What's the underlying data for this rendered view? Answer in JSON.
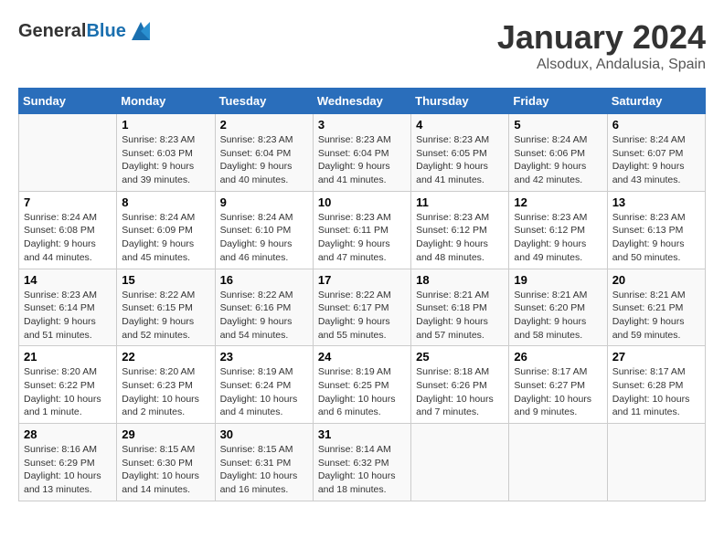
{
  "header": {
    "logo_general": "General",
    "logo_blue": "Blue",
    "title": "January 2024",
    "location": "Alsodux, Andalusia, Spain"
  },
  "days_of_week": [
    "Sunday",
    "Monday",
    "Tuesday",
    "Wednesday",
    "Thursday",
    "Friday",
    "Saturday"
  ],
  "weeks": [
    [
      {
        "day": "",
        "info": ""
      },
      {
        "day": "1",
        "info": "Sunrise: 8:23 AM\nSunset: 6:03 PM\nDaylight: 9 hours\nand 39 minutes."
      },
      {
        "day": "2",
        "info": "Sunrise: 8:23 AM\nSunset: 6:04 PM\nDaylight: 9 hours\nand 40 minutes."
      },
      {
        "day": "3",
        "info": "Sunrise: 8:23 AM\nSunset: 6:04 PM\nDaylight: 9 hours\nand 41 minutes."
      },
      {
        "day": "4",
        "info": "Sunrise: 8:23 AM\nSunset: 6:05 PM\nDaylight: 9 hours\nand 41 minutes."
      },
      {
        "day": "5",
        "info": "Sunrise: 8:24 AM\nSunset: 6:06 PM\nDaylight: 9 hours\nand 42 minutes."
      },
      {
        "day": "6",
        "info": "Sunrise: 8:24 AM\nSunset: 6:07 PM\nDaylight: 9 hours\nand 43 minutes."
      }
    ],
    [
      {
        "day": "7",
        "info": "Sunrise: 8:24 AM\nSunset: 6:08 PM\nDaylight: 9 hours\nand 44 minutes."
      },
      {
        "day": "8",
        "info": "Sunrise: 8:24 AM\nSunset: 6:09 PM\nDaylight: 9 hours\nand 45 minutes."
      },
      {
        "day": "9",
        "info": "Sunrise: 8:24 AM\nSunset: 6:10 PM\nDaylight: 9 hours\nand 46 minutes."
      },
      {
        "day": "10",
        "info": "Sunrise: 8:23 AM\nSunset: 6:11 PM\nDaylight: 9 hours\nand 47 minutes."
      },
      {
        "day": "11",
        "info": "Sunrise: 8:23 AM\nSunset: 6:12 PM\nDaylight: 9 hours\nand 48 minutes."
      },
      {
        "day": "12",
        "info": "Sunrise: 8:23 AM\nSunset: 6:12 PM\nDaylight: 9 hours\nand 49 minutes."
      },
      {
        "day": "13",
        "info": "Sunrise: 8:23 AM\nSunset: 6:13 PM\nDaylight: 9 hours\nand 50 minutes."
      }
    ],
    [
      {
        "day": "14",
        "info": "Sunrise: 8:23 AM\nSunset: 6:14 PM\nDaylight: 9 hours\nand 51 minutes."
      },
      {
        "day": "15",
        "info": "Sunrise: 8:22 AM\nSunset: 6:15 PM\nDaylight: 9 hours\nand 52 minutes."
      },
      {
        "day": "16",
        "info": "Sunrise: 8:22 AM\nSunset: 6:16 PM\nDaylight: 9 hours\nand 54 minutes."
      },
      {
        "day": "17",
        "info": "Sunrise: 8:22 AM\nSunset: 6:17 PM\nDaylight: 9 hours\nand 55 minutes."
      },
      {
        "day": "18",
        "info": "Sunrise: 8:21 AM\nSunset: 6:18 PM\nDaylight: 9 hours\nand 57 minutes."
      },
      {
        "day": "19",
        "info": "Sunrise: 8:21 AM\nSunset: 6:20 PM\nDaylight: 9 hours\nand 58 minutes."
      },
      {
        "day": "20",
        "info": "Sunrise: 8:21 AM\nSunset: 6:21 PM\nDaylight: 9 hours\nand 59 minutes."
      }
    ],
    [
      {
        "day": "21",
        "info": "Sunrise: 8:20 AM\nSunset: 6:22 PM\nDaylight: 10 hours\nand 1 minute."
      },
      {
        "day": "22",
        "info": "Sunrise: 8:20 AM\nSunset: 6:23 PM\nDaylight: 10 hours\nand 2 minutes."
      },
      {
        "day": "23",
        "info": "Sunrise: 8:19 AM\nSunset: 6:24 PM\nDaylight: 10 hours\nand 4 minutes."
      },
      {
        "day": "24",
        "info": "Sunrise: 8:19 AM\nSunset: 6:25 PM\nDaylight: 10 hours\nand 6 minutes."
      },
      {
        "day": "25",
        "info": "Sunrise: 8:18 AM\nSunset: 6:26 PM\nDaylight: 10 hours\nand 7 minutes."
      },
      {
        "day": "26",
        "info": "Sunrise: 8:17 AM\nSunset: 6:27 PM\nDaylight: 10 hours\nand 9 minutes."
      },
      {
        "day": "27",
        "info": "Sunrise: 8:17 AM\nSunset: 6:28 PM\nDaylight: 10 hours\nand 11 minutes."
      }
    ],
    [
      {
        "day": "28",
        "info": "Sunrise: 8:16 AM\nSunset: 6:29 PM\nDaylight: 10 hours\nand 13 minutes."
      },
      {
        "day": "29",
        "info": "Sunrise: 8:15 AM\nSunset: 6:30 PM\nDaylight: 10 hours\nand 14 minutes."
      },
      {
        "day": "30",
        "info": "Sunrise: 8:15 AM\nSunset: 6:31 PM\nDaylight: 10 hours\nand 16 minutes."
      },
      {
        "day": "31",
        "info": "Sunrise: 8:14 AM\nSunset: 6:32 PM\nDaylight: 10 hours\nand 18 minutes."
      },
      {
        "day": "",
        "info": ""
      },
      {
        "day": "",
        "info": ""
      },
      {
        "day": "",
        "info": ""
      }
    ]
  ]
}
